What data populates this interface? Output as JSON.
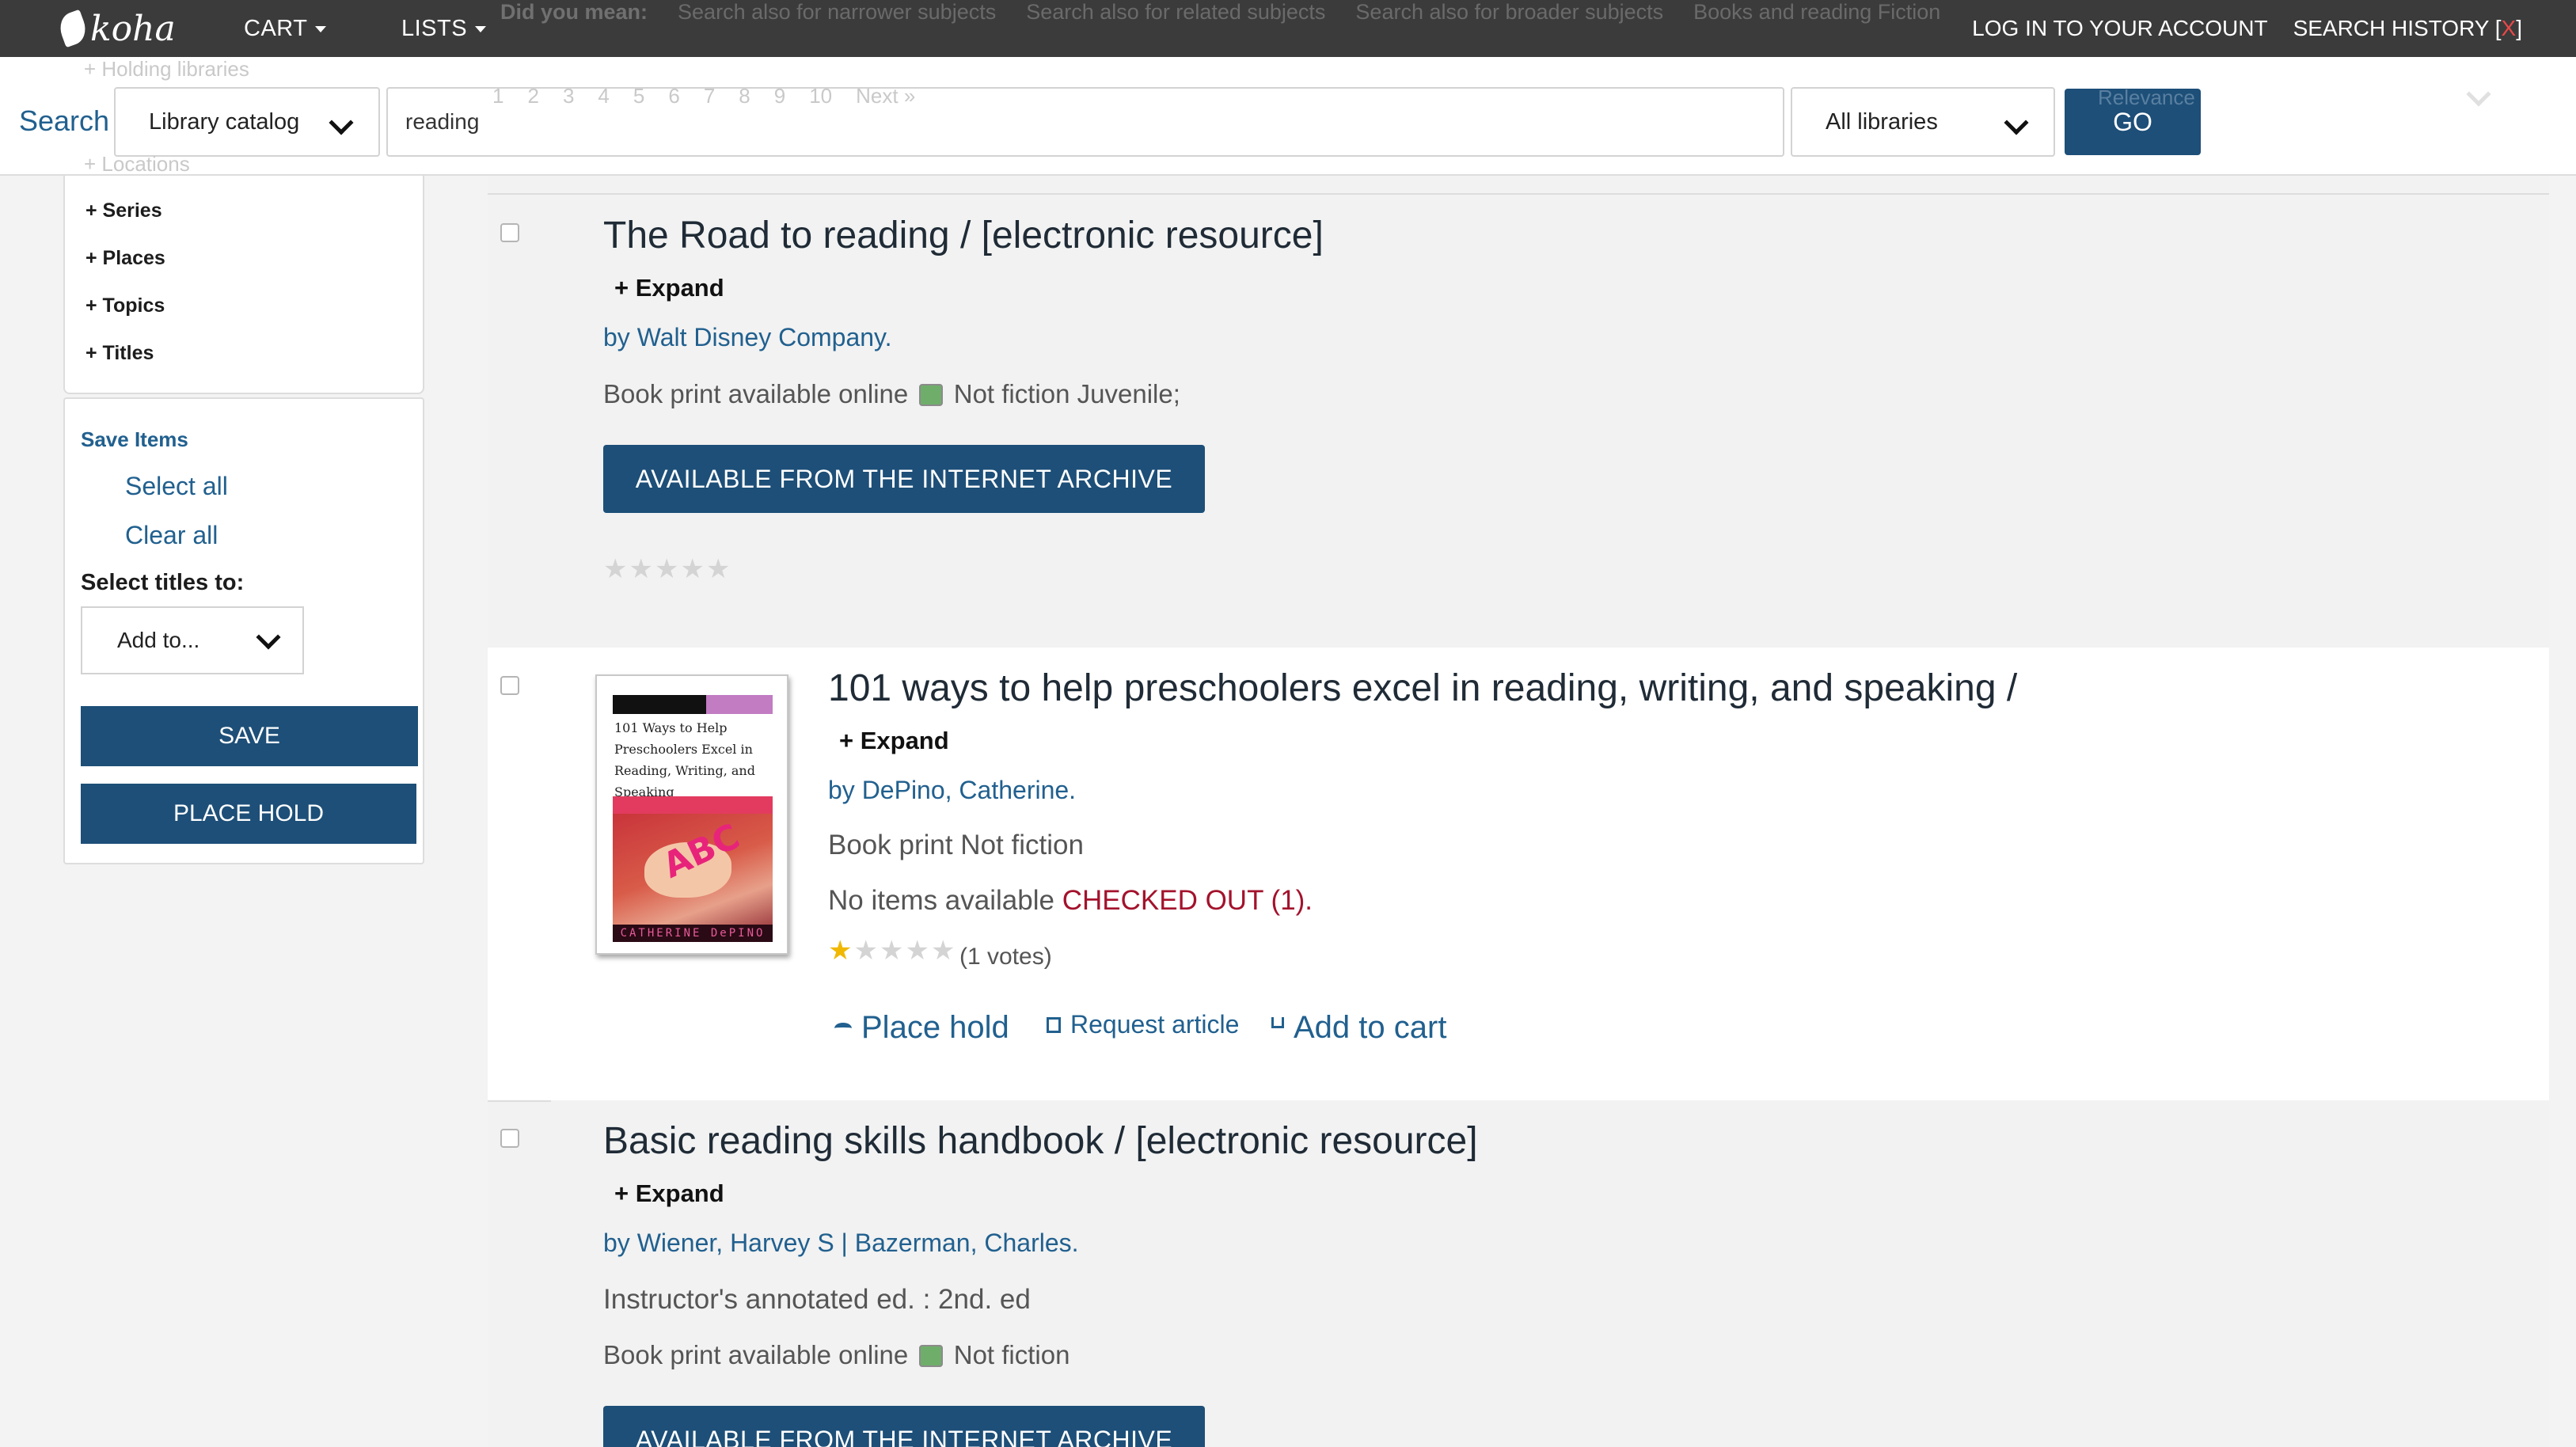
{
  "navbar": {
    "logo_text": "koha",
    "cart_label": "CART",
    "lists_label": "LISTS",
    "ghost_did_you_mean": "Did you mean:",
    "ghost_suggestions": [
      "Search also for narrower subjects",
      "Search also for related subjects",
      "Search also for broader subjects",
      "Books and reading Fiction"
    ],
    "login_label": "LOG IN TO YOUR ACCOUNT",
    "search_history_prefix": "SEARCH HISTORY [",
    "search_history_x": "X",
    "search_history_suffix": "]"
  },
  "search": {
    "label": "Search",
    "scope": "Library catalog",
    "query": "reading",
    "library": "All libraries",
    "go_label": "GO",
    "ghost_pagination": [
      "1",
      "2",
      "3",
      "4",
      "5",
      "6",
      "7",
      "8",
      "9",
      "10",
      "Next »"
    ],
    "ghost_sort": "Relevance",
    "ghost_facets": [
      "+ Holding libraries",
      "+ Locations"
    ]
  },
  "sidebar": {
    "facets": [
      "+ Series",
      "+ Places",
      "+ Topics",
      "+ Titles"
    ],
    "save_items_label": "Save Items",
    "select_all": "Select all",
    "clear_all": "Clear all",
    "select_titles_label": "Select titles to:",
    "add_to": "Add to...",
    "save_button": "SAVE",
    "place_hold_button": "PLACE HOLD"
  },
  "results": [
    {
      "title": "The Road to reading / [electronic resource]",
      "expand": "+ Expand",
      "byline": "by Walt Disney Company.",
      "format": "Book print available online",
      "format_after": "Not fiction Juvenile;",
      "ia_button": "AVAILABLE FROM THE INTERNET ARCHIVE",
      "rating": 0
    },
    {
      "title": "101 ways to help preschoolers excel in reading, writing, and speaking /",
      "expand": "+ Expand",
      "byline": "by DePino, Catherine.",
      "format": "Book print Not fiction",
      "availability": "No items available",
      "status": "CHECKED OUT (1).",
      "rating": 1,
      "votes": "(1 votes)",
      "cover_title": "101 Ways to Help Preschoolers Excel in Reading, Writing, and Speaking",
      "cover_author": "CATHERINE DePINO",
      "cover_letters": "ABC",
      "actions": {
        "place_hold": "Place hold",
        "request_article": "Request article",
        "add_to_cart": "Add to cart"
      }
    },
    {
      "title": "Basic reading skills handbook / [electronic resource]",
      "expand": "+ Expand",
      "byline": "by Wiener, Harvey S | Bazerman, Charles.",
      "edition": "Instructor's annotated ed. : 2nd. ed",
      "format": "Book print available online",
      "format_after": "Not fiction",
      "ia_button": "AVAILABLE FROM THE INTERNET ARCHIVE"
    }
  ],
  "colors": {
    "navbar_bg": "#3b3b3b",
    "primary_button": "#1d4f78",
    "link": "#21608f",
    "checked_out": "#a3122c",
    "star_on": "#f0b800"
  }
}
